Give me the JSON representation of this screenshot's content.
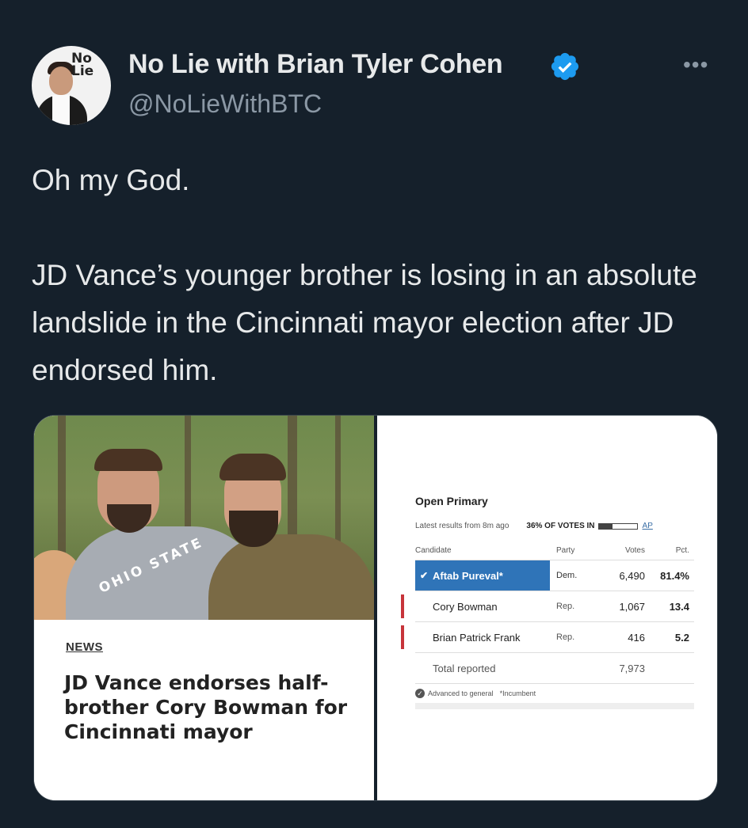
{
  "author": {
    "name": "No Lie with Brian Tyler Cohen",
    "handle": "@NoLieWithBTC",
    "avatar_logo_text": "No Lie",
    "verified": true,
    "verified_color": "#1d9bf0"
  },
  "more_icon": "ellipsis-icon",
  "tweet_text": "Oh my God.\n\nJD Vance’s younger brother is losing in an absolute landslide in the Cincinnati mayor election after JD endorsed him.",
  "left_image": {
    "news_label": "NEWS",
    "headline": "JD Vance endorses half-brother Cory Bowman for Cincinnati mayor",
    "shirt_text": "OHIO STATE"
  },
  "results": {
    "title": "Open Primary",
    "latest": "Latest results from 8m ago",
    "reporting": "36% OF VOTES IN",
    "reporting_fraction": 0.36,
    "source": "AP",
    "headers": {
      "candidate": "Candidate",
      "party": "Party",
      "votes": "Votes",
      "pct": "Pct."
    },
    "rows": [
      {
        "candidate": "Aftab Pureval*",
        "party": "Dem.",
        "votes": "6,490",
        "pct": "81.4%",
        "winner": true
      },
      {
        "candidate": "Cory Bowman",
        "party": "Rep.",
        "votes": "1,067",
        "pct": "13.4",
        "winner": false
      },
      {
        "candidate": "Brian Patrick Frank",
        "party": "Rep.",
        "votes": "416",
        "pct": "5.2",
        "winner": false
      }
    ],
    "total_label": "Total reported",
    "total_votes": "7,973",
    "footnote_advanced": "Advanced to general",
    "footnote_incumbent": "*Incumbent",
    "winner_color": "#2f74b8",
    "rep_color": "#c7343a"
  }
}
